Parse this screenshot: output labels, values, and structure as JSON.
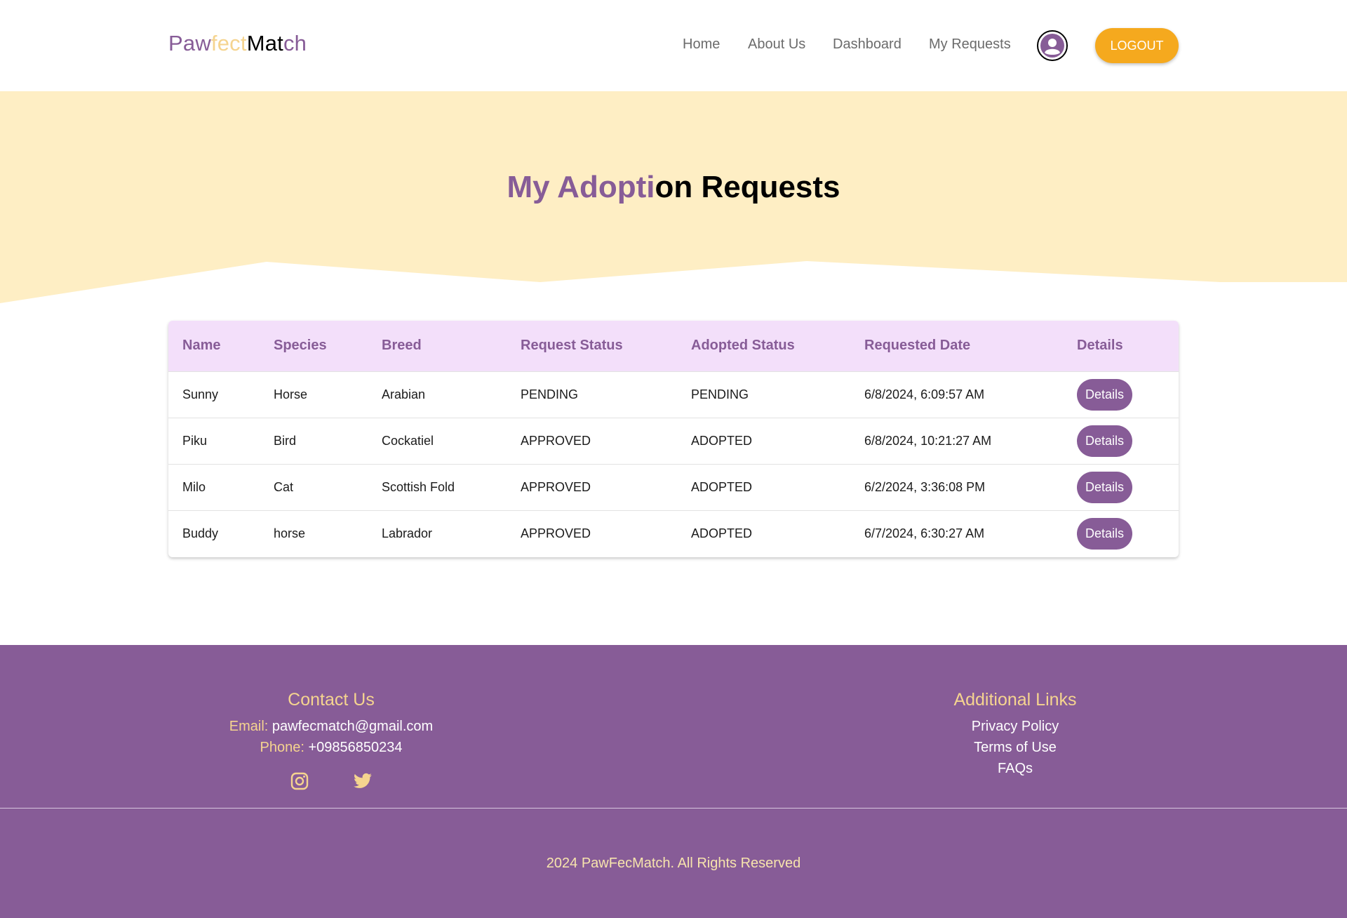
{
  "brand": {
    "part1": "Paw",
    "part2": "fect",
    "part3": "Mat",
    "part4": "ch"
  },
  "nav": {
    "home": "Home",
    "about": "About Us",
    "dashboard": "Dashboard",
    "requests": "My Requests",
    "logout": "LOGOUT"
  },
  "hero": {
    "title_part1": "My Adopti",
    "title_part2": "on Requests"
  },
  "table": {
    "headers": [
      "Name",
      "Species",
      "Breed",
      "Request Status",
      "Adopted Status",
      "Requested Date",
      "Details"
    ],
    "rows": [
      {
        "name": "Sunny",
        "species": "Horse",
        "breed": "Arabian",
        "request_status": "PENDING",
        "adopted_status": "PENDING",
        "date": "6/8/2024, 6:09:57 AM",
        "details": "Details"
      },
      {
        "name": "Piku",
        "species": "Bird",
        "breed": "Cockatiel",
        "request_status": "APPROVED",
        "adopted_status": "ADOPTED",
        "date": "6/8/2024, 10:21:27 AM",
        "details": "Details"
      },
      {
        "name": "Milo",
        "species": "Cat",
        "breed": "Scottish Fold",
        "request_status": "APPROVED",
        "adopted_status": "ADOPTED",
        "date": "6/2/2024, 3:36:08 PM",
        "details": "Details"
      },
      {
        "name": "Buddy",
        "species": "horse",
        "breed": "Labrador",
        "request_status": "APPROVED",
        "adopted_status": "ADOPTED",
        "date": "6/7/2024, 6:30:27 AM",
        "details": "Details"
      }
    ]
  },
  "footer": {
    "contact_title": "Contact Us",
    "email_label": "Email:",
    "email_value": "pawfecmatch@gmail.com",
    "phone_label": "Phone:",
    "phone_value": "+09856850234",
    "links_title": "Additional Links",
    "links": [
      "Privacy Policy",
      "Terms of Use",
      "FAQs"
    ],
    "copyright": "2024 PawFecMatch. All Rights Reserved"
  },
  "icons": {
    "avatar": "user-circle-icon",
    "instagram": "instagram-icon",
    "twitter": "twitter-icon"
  },
  "colors": {
    "brand_purple": "#875c97",
    "brand_yellow": "#f5d48f",
    "accent_orange": "#f5a91e",
    "hero_bg": "#feeec4",
    "table_header_bg": "#f3dffa"
  }
}
